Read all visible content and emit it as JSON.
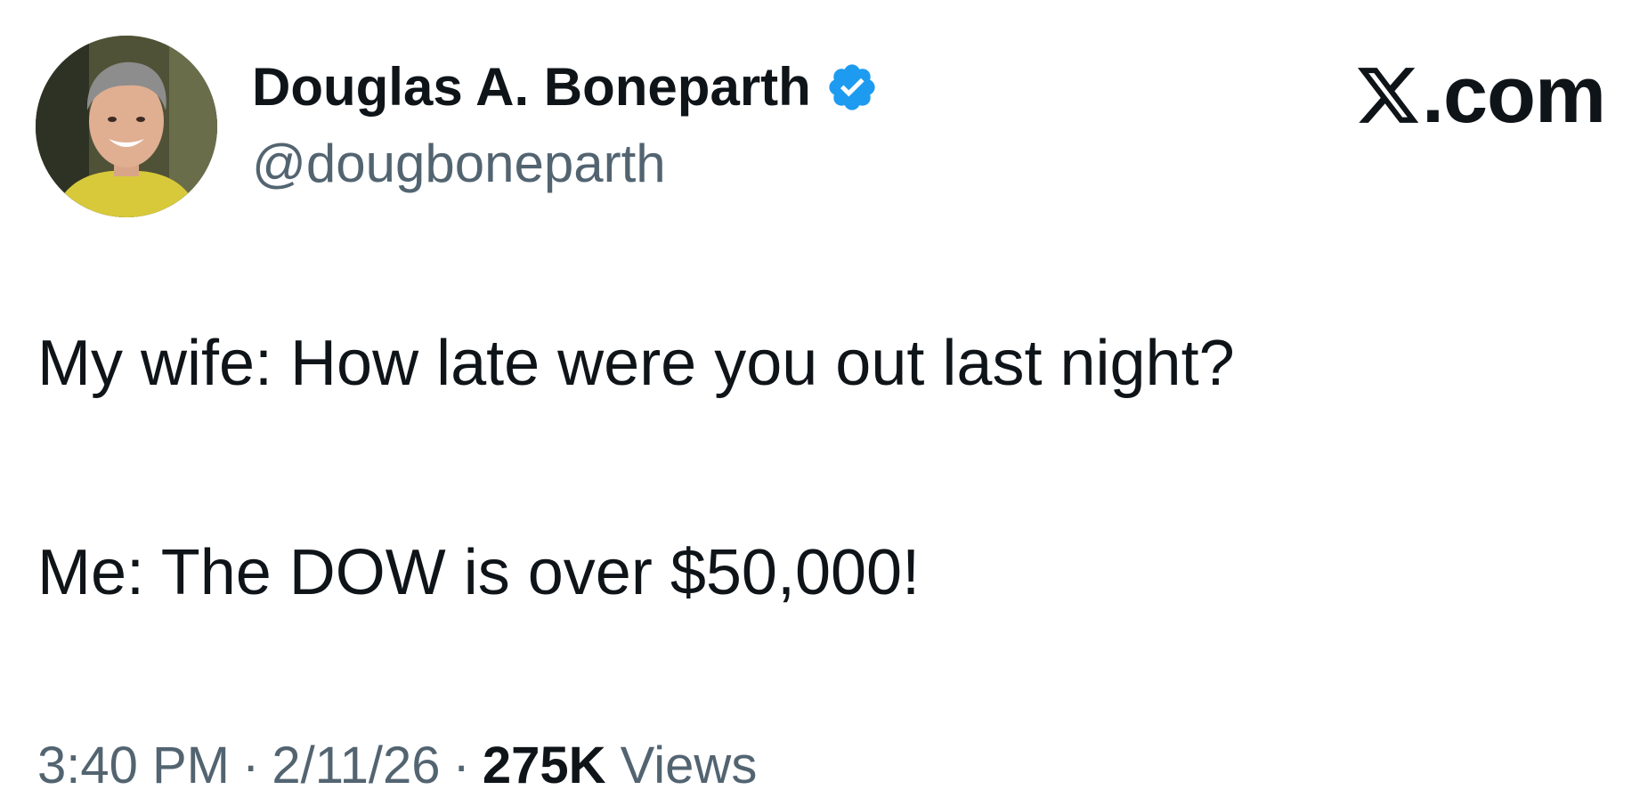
{
  "author": {
    "display_name": "Douglas A. Boneparth",
    "handle": "@dougboneparth",
    "verified": true,
    "verified_badge_color": "#1d9bf0",
    "avatar_icon": "profile-photo"
  },
  "branding": {
    "logo_icon": "x-logo-icon",
    "logo_suffix": ".com"
  },
  "tweet": {
    "lines": [
      "My wife: How late were you out last night?",
      "Me: The DOW is over $50,000!"
    ]
  },
  "meta": {
    "time": "3:40 PM",
    "separator": "·",
    "date": "2/11/26",
    "views_count": "275K",
    "views_label": "Views"
  },
  "colors": {
    "text_primary": "#0f1419",
    "text_secondary": "#536471",
    "background": "#ffffff"
  }
}
